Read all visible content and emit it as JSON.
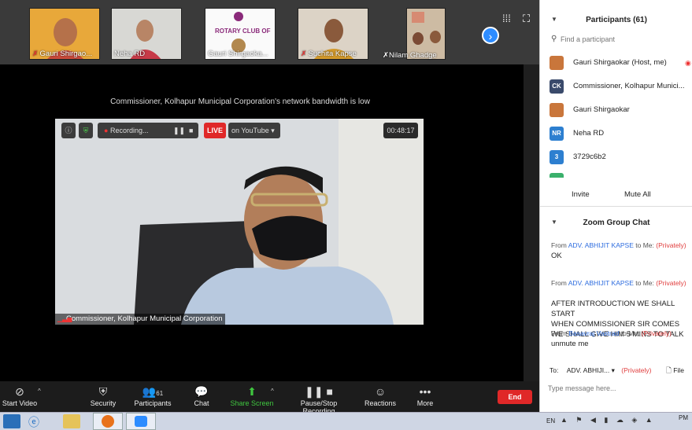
{
  "thumbnails": [
    {
      "name": "Gauri Shirgao..."
    },
    {
      "name": "Neha RD"
    },
    {
      "name": "Gauri Shirgaoka..."
    },
    {
      "name": "Suchita Kapse"
    },
    {
      "name": "Nilam Ghadge"
    }
  ],
  "thumbnail_logo_text": "ROTARY CLUB OF",
  "stage": {
    "bandwidth_warning": "Commissioner, Kolhapur Municipal Corporation's network bandwidth is low",
    "recording_label": "Recording...",
    "live_label": "LIVE",
    "live_platform": "on YouTube",
    "timer": "00:48:17",
    "speaker_label": "Commissioner, Kolhapur Municipal Corporation"
  },
  "toolbar": {
    "start_video": "Start Video",
    "security": "Security",
    "participants": "Participants",
    "participant_count": "61",
    "chat": "Chat",
    "share_screen": "Share Screen",
    "pause_recording": "Pause/Stop Recording",
    "reactions": "Reactions",
    "more": "More",
    "end": "End"
  },
  "participants_panel": {
    "title": "Participants (61)",
    "search_placeholder": "Find a participant",
    "items": [
      {
        "name": "Gauri Shirgaokar (Host, me)",
        "initials": "",
        "color": "#c9763b"
      },
      {
        "name": "Commissioner, Kolhapur Munici...",
        "initials": "CK",
        "color": "#3a4a6b"
      },
      {
        "name": "Gauri Shirgaokar",
        "initials": "",
        "color": "#c9763b"
      },
      {
        "name": "Neha RD",
        "initials": "NR",
        "color": "#2d7fd0"
      },
      {
        "name": "3729c6b2",
        "initials": "3",
        "color": "#2d7fd0"
      }
    ],
    "invite": "Invite",
    "mute_all": "Mute All"
  },
  "chat_panel": {
    "title": "Zoom Group Chat",
    "messages": [
      {
        "from": "From",
        "sender": "ADV. ABHIJIT KAPSE",
        "to": "to Me:",
        "privacy": "(Privately)",
        "text": "OK"
      },
      {
        "from": "From",
        "sender": "ADV. ABHIJIT KAPSE",
        "to": "to Me:",
        "privacy": "(Privately)",
        "text": "AFTER INTRODUCTION WE SHALL START\nWHEN COMMISSIONER SIR COMES WE SHALL GIVE HIM 5 MINS TO TALK"
      },
      {
        "from": "From",
        "sender": "Basavraj Vastrad",
        "to": "to Me:",
        "privacy": "(Privately)",
        "text": "unmute me"
      }
    ],
    "to_label": "To:",
    "to_value": "ADV. ABHIJI...",
    "to_privacy": "(Privately)",
    "file_label": "File",
    "input_placeholder": "Type message here..."
  },
  "taskbar": {
    "lang": "EN",
    "time": "PM"
  }
}
